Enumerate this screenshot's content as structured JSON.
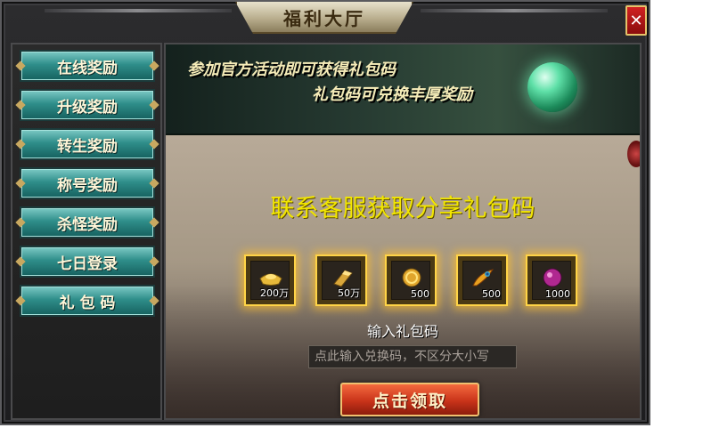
{
  "window": {
    "title": "福利大厅",
    "close_symbol": "✕"
  },
  "sidebar": {
    "items": [
      {
        "label": "在线奖励"
      },
      {
        "label": "升级奖励"
      },
      {
        "label": "转生奖励"
      },
      {
        "label": "称号奖励"
      },
      {
        "label": "杀怪奖励"
      },
      {
        "label": "七日登录"
      },
      {
        "label": "礼 包 码"
      }
    ]
  },
  "banner": {
    "line1": "参加官方活动即可获得礼包码",
    "line2": "礼包码可兑换丰厚奖励"
  },
  "main": {
    "headline": "联系客服获取分享礼包码",
    "rewards": [
      {
        "amount": "200万",
        "icon": "gold-ingot-icon"
      },
      {
        "amount": "50万",
        "icon": "gold-bar-icon"
      },
      {
        "amount": "500",
        "icon": "gold-coin-icon"
      },
      {
        "amount": "500",
        "icon": "phoenix-feather-icon"
      },
      {
        "amount": "1000",
        "icon": "purple-gem-icon"
      }
    ],
    "input_label": "输入礼包码",
    "input_placeholder": "点此输入兑换码，不区分大小写",
    "input_value": "",
    "claim_label": "点击领取"
  },
  "colors": {
    "headline": "#f2e600",
    "nav_button": "#2f8e8a",
    "claim_button": "#c9331a",
    "slot_glow": "#ffd447"
  }
}
